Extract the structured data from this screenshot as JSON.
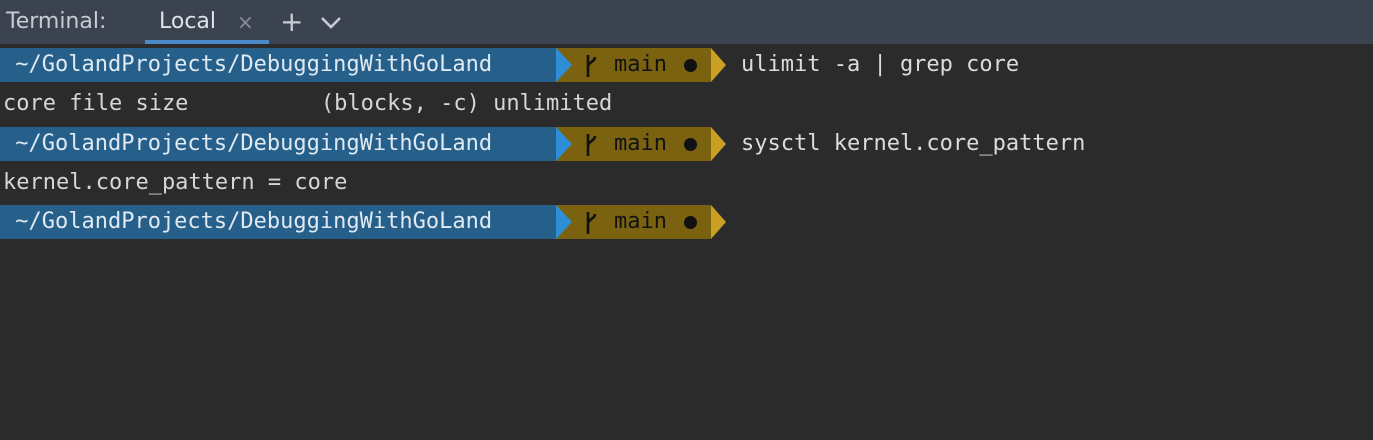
{
  "tabbar": {
    "title": "Terminal:",
    "tab_label": "Local",
    "close_glyph": "×",
    "add_glyph": "+"
  },
  "prompt": {
    "path": " ~/GolandProjects/DebuggingWithGoLand",
    "branch": "main"
  },
  "lines": [
    {
      "type": "prompt",
      "command": "ulimit -a | grep core"
    },
    {
      "type": "output",
      "text": "core file size          (blocks, -c) unlimited"
    },
    {
      "type": "prompt",
      "command": "sysctl kernel.core_pattern"
    },
    {
      "type": "output",
      "text": "kernel.core_pattern = core"
    },
    {
      "type": "prompt",
      "command": ""
    }
  ],
  "colors": {
    "path_bg": "#255f8a",
    "git_bg": "#7a6211",
    "arrow_blue": "#2f8fd6",
    "arrow_gold": "#c9a024",
    "terminal_bg": "#2b2b2b"
  }
}
